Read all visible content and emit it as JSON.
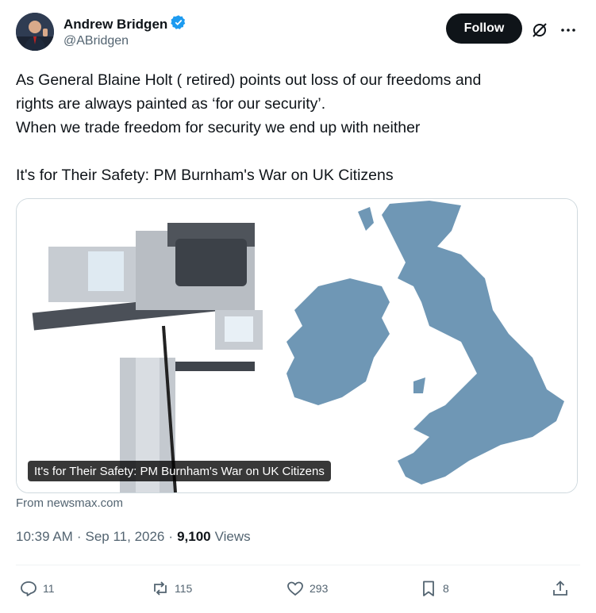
{
  "author": {
    "name": "Andrew Bridgen",
    "handle": "@ABridgen",
    "verified": true,
    "follow_label": "Follow"
  },
  "tweet": {
    "text": "As General Blaine Holt ( retired) points out loss of our freedoms and\nrights are always painted as ‘for our security’.\nWhen we trade freedom for security we end up with neither\n\nIt's for Their Safety: PM Burnham's War on UK Citizens"
  },
  "card": {
    "caption": "It's for Their Safety: PM Burnham's War on UK Citizens",
    "source": "From newsmax.com"
  },
  "meta": {
    "time": "10:39 AM",
    "sep1": "·",
    "date": "Sep 11, 2026",
    "sep2": "·",
    "views_count": "9,100",
    "views_label": "Views"
  },
  "actions": {
    "replies": "11",
    "reposts": "115",
    "likes": "293",
    "bookmarks": "8"
  },
  "colors": {
    "text": "#0f1419",
    "secondary": "#536471",
    "verified": "#1d9bf0",
    "map": "#6f97b5"
  },
  "icons": [
    "verified-badge-icon",
    "grok-icon",
    "more-icon",
    "reply-icon",
    "repost-icon",
    "like-icon",
    "bookmark-icon",
    "share-icon"
  ]
}
